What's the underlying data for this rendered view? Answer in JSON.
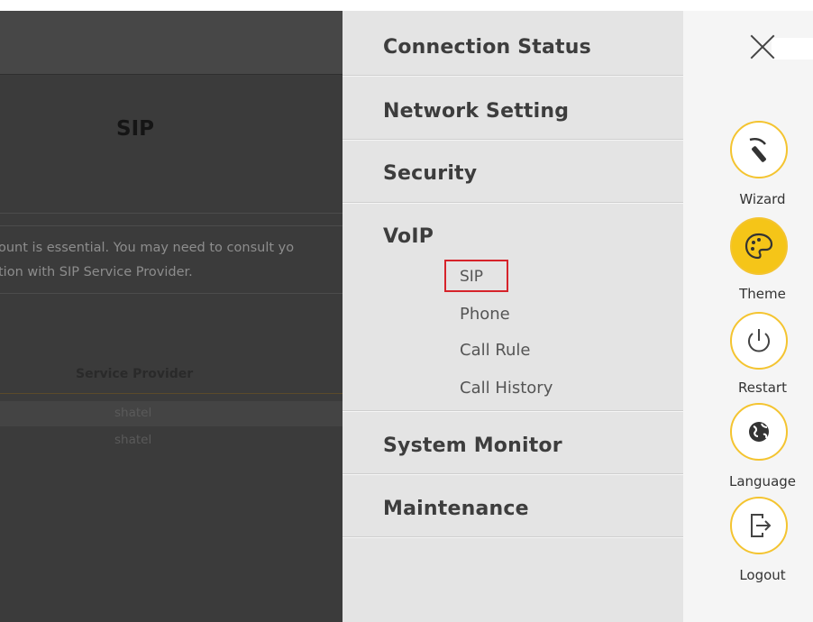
{
  "background_page": {
    "title": "SIP",
    "description_line1": "ount is essential. You may need to consult yo",
    "description_line2": "tion with SIP Service Provider.",
    "table_header": "Service Provider",
    "rows": [
      "shatel",
      "shatel"
    ]
  },
  "menu": {
    "sections": {
      "connection_status": "Connection Status",
      "network_setting": "Network Setting",
      "security": "Security",
      "voip": "VoIP",
      "system_monitor": "System Monitor",
      "maintenance": "Maintenance"
    },
    "voip_items": {
      "sip": "SIP",
      "phone": "Phone",
      "call_rule": "Call Rule",
      "call_history": "Call History"
    }
  },
  "side_panel": {
    "wizard": "Wizard",
    "theme": "Theme",
    "restart": "Restart",
    "language": "Language",
    "logout": "Logout"
  },
  "colors": {
    "accent": "#f5c518",
    "highlight_box": "#d6232a"
  }
}
